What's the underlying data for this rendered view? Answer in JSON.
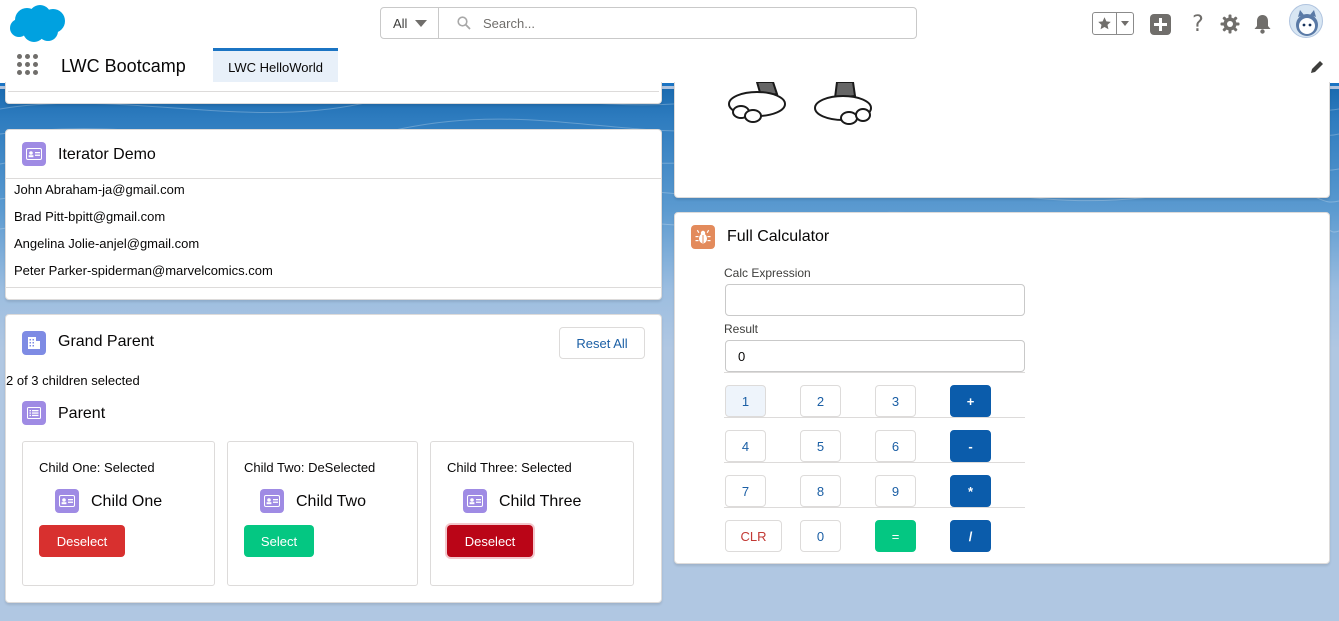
{
  "header": {
    "search_scope": "All",
    "search_placeholder": "Search..."
  },
  "nav": {
    "app_name": "LWC Bootcamp",
    "tab_label": "LWC HelloWorld"
  },
  "iterator": {
    "title": "Iterator Demo",
    "items": [
      "John Abraham-ja@gmail.com",
      "Brad Pitt-bpitt@gmail.com",
      "Angelina Jolie-anjel@gmail.com",
      "Peter Parker-spiderman@marvelcomics.com"
    ]
  },
  "grand_parent": {
    "title": "Grand Parent",
    "reset_label": "Reset All",
    "summary": "2 of 3 children selected",
    "parent_title": "Parent",
    "children": [
      {
        "status": "Child One: Selected",
        "name": "Child One",
        "button": "Deselect",
        "button_color": "#d8302f"
      },
      {
        "status": "Child Two: DeSelected",
        "name": "Child Two",
        "button": "Select",
        "button_color": "#04c782"
      },
      {
        "status": "Child Three: Selected",
        "name": "Child Three",
        "button": "Deselect",
        "button_color": "#ba0517"
      }
    ]
  },
  "calculator": {
    "title": "Full Calculator",
    "expression_label": "Calc Expression",
    "expression_value": "",
    "result_label": "Result",
    "result_value": "0",
    "keys": [
      [
        "1",
        "2",
        "3",
        "+"
      ],
      [
        "4",
        "5",
        "6",
        "-"
      ],
      [
        "7",
        "8",
        "9",
        "*"
      ],
      [
        "CLR",
        "0",
        "=",
        "/"
      ]
    ]
  },
  "colors": {
    "brand": "#1b74c3",
    "link": "#1b5fa5",
    "operator_key": "#0b5cab",
    "equals_key": "#04c782"
  }
}
